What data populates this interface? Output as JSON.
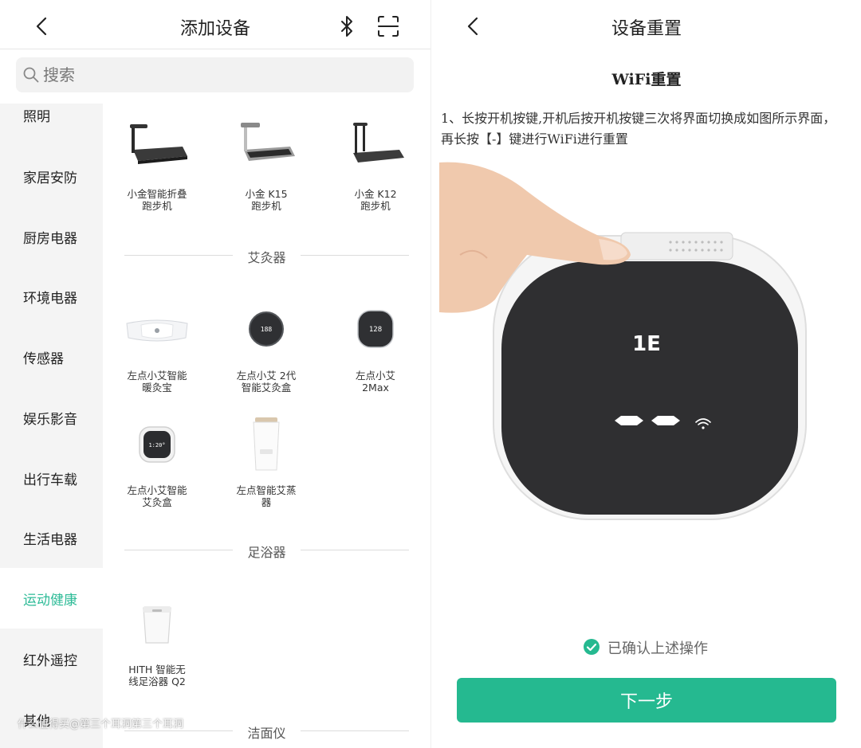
{
  "left": {
    "header": {
      "title": "添加设备"
    },
    "search": {
      "placeholder": "搜索"
    },
    "sidebar": {
      "items": [
        {
          "label": "照明"
        },
        {
          "label": "家居安防"
        },
        {
          "label": "厨房电器"
        },
        {
          "label": "环境电器"
        },
        {
          "label": "传感器"
        },
        {
          "label": "娱乐影音"
        },
        {
          "label": "出行车载"
        },
        {
          "label": "生活电器"
        },
        {
          "label": "运动健康",
          "active": true
        },
        {
          "label": "红外遥控"
        },
        {
          "label": "其他"
        }
      ]
    },
    "devices": {
      "treadmills": [
        {
          "line1": "小金智能折叠",
          "line2": "跑步机"
        },
        {
          "line1": "小金 K15",
          "line2": "跑步机"
        },
        {
          "line1": "小金 K12",
          "line2": "跑步机"
        }
      ],
      "moxa_section": "艾灸器",
      "moxa": [
        {
          "line1": "左点小艾智能",
          "line2": "暖灸宝"
        },
        {
          "line1": "左点小艾 2代",
          "line2": "智能艾灸盒",
          "display": "188"
        },
        {
          "line1": "左点小艾",
          "line2": "2Max",
          "display": "128"
        },
        {
          "line1": "左点小艾智能",
          "line2": "艾灸盒",
          "display": "1:20°"
        },
        {
          "line1": "左点智能艾蒸",
          "line2": "器"
        }
      ],
      "footbath_section": "足浴器",
      "footbath": [
        {
          "line1": "HITH 智能无",
          "line2": "线足浴器 Q2"
        }
      ],
      "cleanser_section": "洁面仪"
    },
    "watermark": "什么值得买@第三个耳洞第三个耳洞"
  },
  "right": {
    "header": {
      "title": "设备重置"
    },
    "subtitle": "WiFi重置",
    "step_text": "1、长按开机按键,开机后按开机按键三次将界面切换成如图所示界面，再长按【-】键进行WiFi进行重置",
    "device_logo": "1E",
    "confirm_text": "已确认上述操作",
    "confirmed": true,
    "next_button": "下一步"
  },
  "colors": {
    "accent": "#25b990",
    "active_nav": "#2dbb97",
    "sidebar_bg": "#f4f4f4",
    "search_bg": "#f2f2f2"
  },
  "icons": [
    "back-arrow-icon",
    "bluetooth-icon",
    "scan-icon",
    "search-icon",
    "check-circle-icon"
  ]
}
